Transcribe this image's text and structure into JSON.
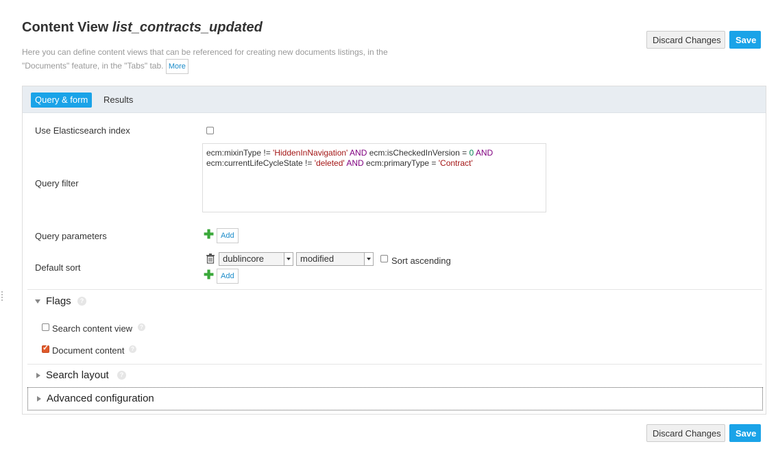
{
  "header": {
    "title_prefix": "Content View",
    "title_name": "list_contracts_updated",
    "description": "Here you can define content views that can be referenced for creating new documents listings, in the \"Documents\" feature, in the \"Tabs\" tab.",
    "more_label": "More"
  },
  "actions": {
    "discard_label": "Discard Changes",
    "save_label": "Save"
  },
  "tabs": [
    {
      "label": "Query & form",
      "active": true
    },
    {
      "label": "Results",
      "active": false
    }
  ],
  "form": {
    "use_es_label": "Use Elasticsearch index",
    "use_es_checked": false,
    "query_filter_label": "Query filter",
    "query_filter": {
      "line1": [
        {
          "t": "ecm:mixinType != ",
          "c": "plain"
        },
        {
          "t": "'HiddenInNavigation'",
          "c": "str"
        },
        {
          "t": " AND ",
          "c": "kw"
        },
        {
          "t": "ecm:isCheckedInVersion = ",
          "c": "plain"
        },
        {
          "t": "0",
          "c": "num"
        },
        {
          "t": " AND",
          "c": "kw"
        }
      ],
      "line2": [
        {
          "t": "ecm:currentLifeCycleState != ",
          "c": "plain"
        },
        {
          "t": "'deleted'",
          "c": "str"
        },
        {
          "t": " AND ",
          "c": "kw"
        },
        {
          "t": "ecm:primaryType = ",
          "c": "plain"
        },
        {
          "t": "'Contract'",
          "c": "str"
        }
      ]
    },
    "query_params_label": "Query parameters",
    "add_label": "Add",
    "default_sort_label": "Default sort",
    "sort_schema": "dublincore",
    "sort_field": "modified",
    "sort_ascending_label": "Sort ascending",
    "sort_ascending_checked": false
  },
  "flags": {
    "title": "Flags",
    "help": "?",
    "search_content_view_label": "Search content view",
    "search_content_view_checked": false,
    "document_content_label": "Document content",
    "document_content_checked": true
  },
  "sections": {
    "search_layout": "Search layout",
    "advanced_configuration": "Advanced configuration"
  }
}
